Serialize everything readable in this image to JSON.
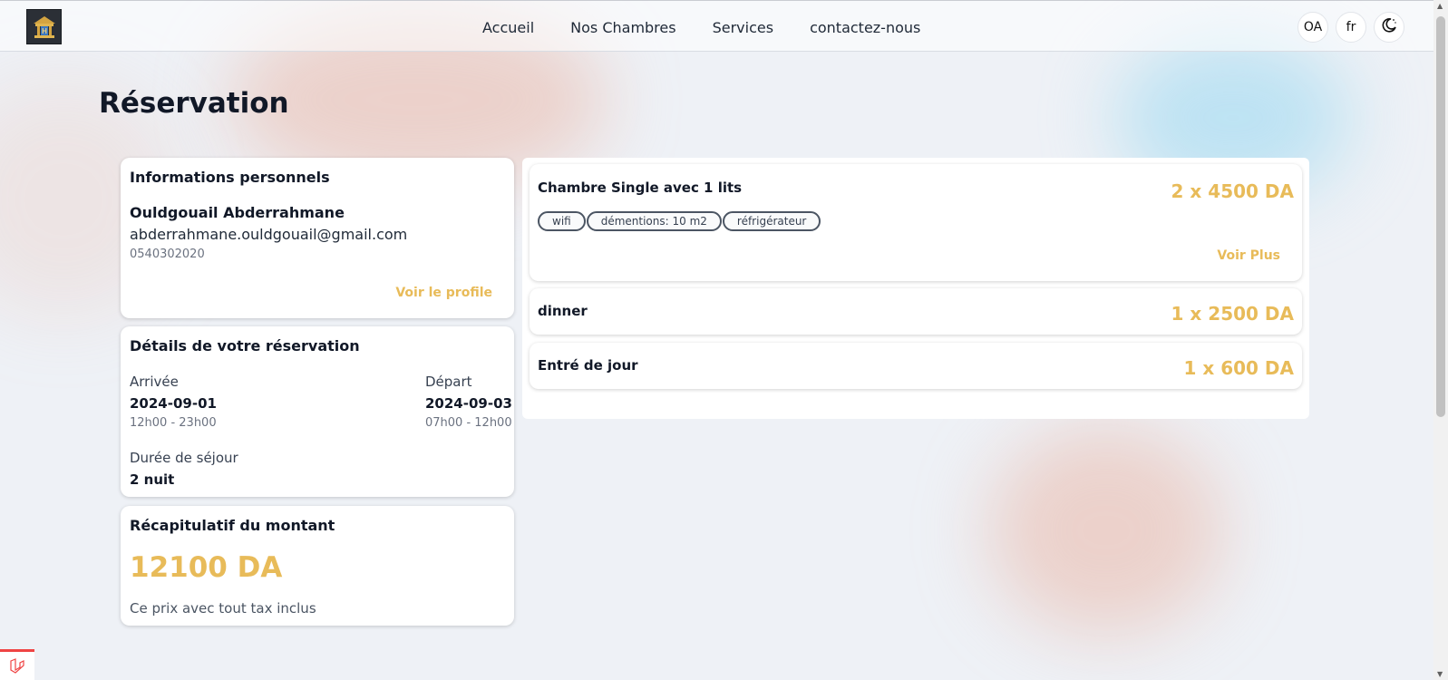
{
  "nav": {
    "links": [
      "Accueil",
      "Nos Chambres",
      "Services",
      "contactez-nous"
    ],
    "user_initials": "OA",
    "language": "fr"
  },
  "page": {
    "title": "Réservation"
  },
  "personal": {
    "heading": "Informations personnels",
    "name": "Ouldgouail Abderrahmane",
    "email": "abderrahmane.ouldgouail@gmail.com",
    "phone": "0540302020",
    "profile_link": "Voir le profile"
  },
  "details": {
    "heading": "Détails de votre réservation",
    "arrival_label": "Arrivée",
    "arrival_date": "2024-09-01",
    "arrival_hours": "12h00 - 23h00",
    "departure_label": "Départ",
    "departure_date": "2024-09-03",
    "departure_hours": "07h00 - 12h00",
    "duration_label": "Durée de séjour",
    "duration_value": "2 nuit"
  },
  "summary": {
    "heading": "Récapitulatif du montant",
    "amount": "12100 DA",
    "note": "Ce prix avec tout tax inclus"
  },
  "items": [
    {
      "name": "Chambre Single avec 1 lits",
      "price": "2 x 4500 DA",
      "tags": [
        "wifi",
        "démentions: 10 m2",
        "réfrigérateur"
      ],
      "more": "Voir Plus"
    },
    {
      "name": "dinner",
      "price": "1 x 2500 DA"
    },
    {
      "name": "Entré de jour",
      "price": "1 x 600 DA"
    }
  ],
  "colors": {
    "accent": "#e8bb59",
    "background": "#eef1f6"
  },
  "icons": {
    "theme_toggle": "moon-icon",
    "logo": "hotel-logo-icon",
    "corner": "laravel-icon"
  }
}
